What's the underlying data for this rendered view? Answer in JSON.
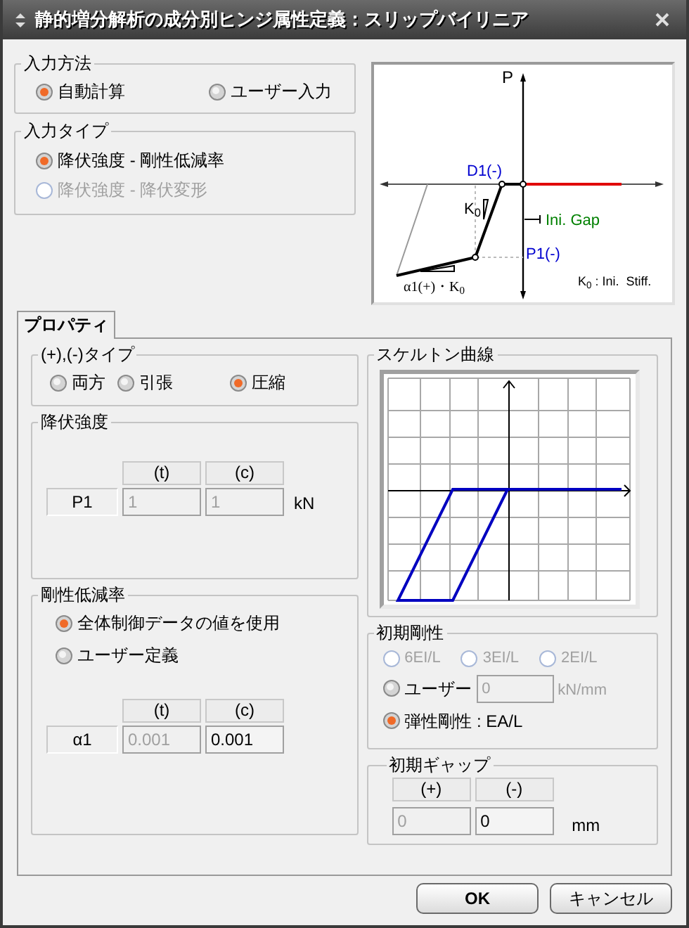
{
  "window": {
    "title": "静的増分解析の成分別ヒンジ属性定義：スリップバイリニア"
  },
  "input_method": {
    "title": "入力方法",
    "options": [
      {
        "label": "自動計算",
        "selected": true,
        "disabled": false
      },
      {
        "label": "ユーザー入力",
        "selected": false,
        "disabled": false
      }
    ]
  },
  "input_type": {
    "title": "入力タイプ",
    "options": [
      {
        "label": "降伏強度 - 剛性低減率",
        "selected": true,
        "disabled": false
      },
      {
        "label": "降伏強度 - 降伏変形",
        "selected": false,
        "disabled": true
      }
    ]
  },
  "diagram": {
    "labels": [
      {
        "kind": "axis",
        "text": "P"
      },
      {
        "kind": "point",
        "text": "D1(-)"
      },
      {
        "kind": "stiffness",
        "text": "K$_{0}$"
      },
      {
        "kind": "gap",
        "text": "Ini. Gap"
      },
      {
        "kind": "strength",
        "text": "P1(-)"
      },
      {
        "kind": "ratio",
        "text": "α1(+)・K$_{0}$"
      },
      {
        "kind": "legend",
        "text": "K$_{0}$ : Ini.  Stiff."
      }
    ]
  },
  "tabs": [
    {
      "label": "プロパティ",
      "selected": true
    }
  ],
  "sign_type": {
    "title": "(+),(-)タイプ",
    "options": [
      {
        "label": "両方",
        "selected": false
      },
      {
        "label": "引張",
        "selected": false
      },
      {
        "label": "圧縮",
        "selected": true
      }
    ]
  },
  "yield_strength": {
    "title": "降伏強度",
    "columns": [
      "(t)",
      "(c)"
    ],
    "row_label": "P1",
    "values": [
      {
        "value": "1",
        "disabled": true
      },
      {
        "value": "1",
        "disabled": true
      }
    ],
    "unit": "kN"
  },
  "stiffness_reduction": {
    "title": "剛性低減率",
    "options": [
      {
        "label": "全体制御データの値を使用",
        "selected": true
      },
      {
        "label": "ユーザー定義",
        "selected": false
      }
    ],
    "columns": [
      "(t)",
      "(c)"
    ],
    "row_label": "α1",
    "values": [
      {
        "value": "0.001",
        "disabled": true
      },
      {
        "value": "0.001",
        "disabled": false
      }
    ]
  },
  "skeleton_curve": {
    "title": "スケルトン曲線"
  },
  "initial_stiffness": {
    "title": "初期剛性",
    "options": [
      {
        "kind": "small",
        "label": "6EI/L",
        "selected": false,
        "disabled": true
      },
      {
        "kind": "small",
        "label": "3EI/L",
        "selected": false,
        "disabled": true
      },
      {
        "kind": "small",
        "label": "2EI/L",
        "selected": false,
        "disabled": true
      },
      {
        "kind": "field",
        "label": "ユーザー",
        "selected": false,
        "disabled": false,
        "value": "0",
        "unit": "kN/mm"
      },
      {
        "kind": "plain",
        "label": "弾性剛性 : EA/L",
        "selected": true,
        "disabled": false
      }
    ]
  },
  "initial_gap": {
    "title": "初期ギャップ",
    "columns": [
      "(+)",
      "(-)"
    ],
    "values": [
      {
        "value": "0",
        "disabled": true
      },
      {
        "value": "0",
        "disabled": false
      }
    ],
    "unit": "mm"
  },
  "buttons": [
    {
      "label": "OK",
      "default": true
    },
    {
      "label": "キャンセル",
      "default": false
    }
  ]
}
